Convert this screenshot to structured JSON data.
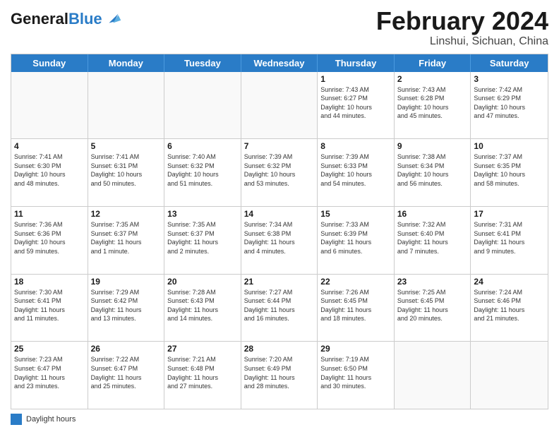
{
  "header": {
    "logo_line1": "General",
    "logo_line2": "Blue",
    "month_title": "February 2024",
    "location": "Linshui, Sichuan, China"
  },
  "weekdays": [
    "Sunday",
    "Monday",
    "Tuesday",
    "Wednesday",
    "Thursday",
    "Friday",
    "Saturday"
  ],
  "legend": {
    "label": "Daylight hours"
  },
  "weeks": [
    [
      {
        "day": "",
        "info": ""
      },
      {
        "day": "",
        "info": ""
      },
      {
        "day": "",
        "info": ""
      },
      {
        "day": "",
        "info": ""
      },
      {
        "day": "1",
        "info": "Sunrise: 7:43 AM\nSunset: 6:27 PM\nDaylight: 10 hours\nand 44 minutes."
      },
      {
        "day": "2",
        "info": "Sunrise: 7:43 AM\nSunset: 6:28 PM\nDaylight: 10 hours\nand 45 minutes."
      },
      {
        "day": "3",
        "info": "Sunrise: 7:42 AM\nSunset: 6:29 PM\nDaylight: 10 hours\nand 47 minutes."
      }
    ],
    [
      {
        "day": "4",
        "info": "Sunrise: 7:41 AM\nSunset: 6:30 PM\nDaylight: 10 hours\nand 48 minutes."
      },
      {
        "day": "5",
        "info": "Sunrise: 7:41 AM\nSunset: 6:31 PM\nDaylight: 10 hours\nand 50 minutes."
      },
      {
        "day": "6",
        "info": "Sunrise: 7:40 AM\nSunset: 6:32 PM\nDaylight: 10 hours\nand 51 minutes."
      },
      {
        "day": "7",
        "info": "Sunrise: 7:39 AM\nSunset: 6:32 PM\nDaylight: 10 hours\nand 53 minutes."
      },
      {
        "day": "8",
        "info": "Sunrise: 7:39 AM\nSunset: 6:33 PM\nDaylight: 10 hours\nand 54 minutes."
      },
      {
        "day": "9",
        "info": "Sunrise: 7:38 AM\nSunset: 6:34 PM\nDaylight: 10 hours\nand 56 minutes."
      },
      {
        "day": "10",
        "info": "Sunrise: 7:37 AM\nSunset: 6:35 PM\nDaylight: 10 hours\nand 58 minutes."
      }
    ],
    [
      {
        "day": "11",
        "info": "Sunrise: 7:36 AM\nSunset: 6:36 PM\nDaylight: 10 hours\nand 59 minutes."
      },
      {
        "day": "12",
        "info": "Sunrise: 7:35 AM\nSunset: 6:37 PM\nDaylight: 11 hours\nand 1 minute."
      },
      {
        "day": "13",
        "info": "Sunrise: 7:35 AM\nSunset: 6:37 PM\nDaylight: 11 hours\nand 2 minutes."
      },
      {
        "day": "14",
        "info": "Sunrise: 7:34 AM\nSunset: 6:38 PM\nDaylight: 11 hours\nand 4 minutes."
      },
      {
        "day": "15",
        "info": "Sunrise: 7:33 AM\nSunset: 6:39 PM\nDaylight: 11 hours\nand 6 minutes."
      },
      {
        "day": "16",
        "info": "Sunrise: 7:32 AM\nSunset: 6:40 PM\nDaylight: 11 hours\nand 7 minutes."
      },
      {
        "day": "17",
        "info": "Sunrise: 7:31 AM\nSunset: 6:41 PM\nDaylight: 11 hours\nand 9 minutes."
      }
    ],
    [
      {
        "day": "18",
        "info": "Sunrise: 7:30 AM\nSunset: 6:41 PM\nDaylight: 11 hours\nand 11 minutes."
      },
      {
        "day": "19",
        "info": "Sunrise: 7:29 AM\nSunset: 6:42 PM\nDaylight: 11 hours\nand 13 minutes."
      },
      {
        "day": "20",
        "info": "Sunrise: 7:28 AM\nSunset: 6:43 PM\nDaylight: 11 hours\nand 14 minutes."
      },
      {
        "day": "21",
        "info": "Sunrise: 7:27 AM\nSunset: 6:44 PM\nDaylight: 11 hours\nand 16 minutes."
      },
      {
        "day": "22",
        "info": "Sunrise: 7:26 AM\nSunset: 6:45 PM\nDaylight: 11 hours\nand 18 minutes."
      },
      {
        "day": "23",
        "info": "Sunrise: 7:25 AM\nSunset: 6:45 PM\nDaylight: 11 hours\nand 20 minutes."
      },
      {
        "day": "24",
        "info": "Sunrise: 7:24 AM\nSunset: 6:46 PM\nDaylight: 11 hours\nand 21 minutes."
      }
    ],
    [
      {
        "day": "25",
        "info": "Sunrise: 7:23 AM\nSunset: 6:47 PM\nDaylight: 11 hours\nand 23 minutes."
      },
      {
        "day": "26",
        "info": "Sunrise: 7:22 AM\nSunset: 6:47 PM\nDaylight: 11 hours\nand 25 minutes."
      },
      {
        "day": "27",
        "info": "Sunrise: 7:21 AM\nSunset: 6:48 PM\nDaylight: 11 hours\nand 27 minutes."
      },
      {
        "day": "28",
        "info": "Sunrise: 7:20 AM\nSunset: 6:49 PM\nDaylight: 11 hours\nand 28 minutes."
      },
      {
        "day": "29",
        "info": "Sunrise: 7:19 AM\nSunset: 6:50 PM\nDaylight: 11 hours\nand 30 minutes."
      },
      {
        "day": "",
        "info": ""
      },
      {
        "day": "",
        "info": ""
      }
    ]
  ]
}
